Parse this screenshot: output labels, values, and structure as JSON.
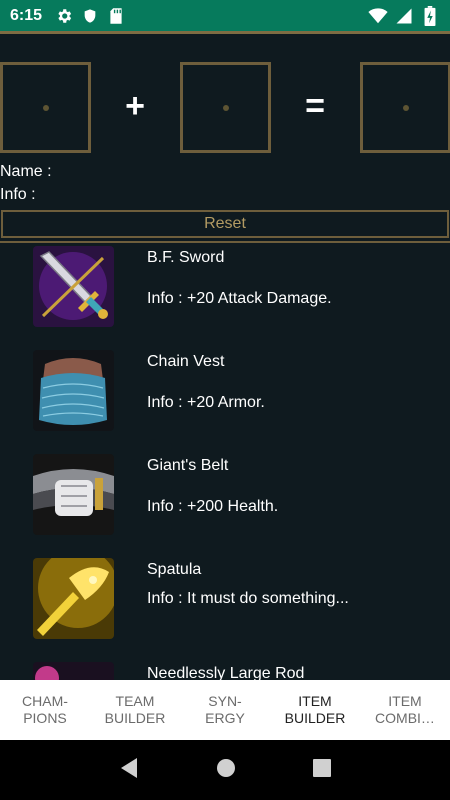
{
  "status_bar": {
    "time": "6:15",
    "icons_left": [
      "settings-icon",
      "shield-icon",
      "sd-card-icon"
    ],
    "icons_right": [
      "wifi-icon",
      "signal-icon",
      "battery-charging-icon"
    ],
    "background": "#067a5c"
  },
  "combiner": {
    "plus": "+",
    "equals": "=",
    "name_label": "Name :",
    "info_label": "Info :",
    "reset_label": "Reset"
  },
  "items": [
    {
      "name": "B.F. Sword",
      "info": "Info : +20 Attack Damage.",
      "icon": "bf-sword-icon"
    },
    {
      "name": "Chain Vest",
      "info": "Info : +20 Armor.",
      "icon": "chain-vest-icon"
    },
    {
      "name": "Giant's Belt",
      "info": "Info : +200 Health.",
      "icon": "giants-belt-icon"
    },
    {
      "name": "Spatula",
      "info": "Info : It must do something...",
      "icon": "spatula-icon"
    },
    {
      "name": "Needlessly Large Rod",
      "info": "",
      "icon": "needlessly-large-rod-icon"
    }
  ],
  "tabs": [
    {
      "label": "CHAM-\nPIONS",
      "active": false
    },
    {
      "label": "TEAM\nBUILDER",
      "active": false
    },
    {
      "label": "SYN-\nERGY",
      "active": false
    },
    {
      "label": "ITEM\nBUILDER",
      "active": true
    },
    {
      "label": "ITEM\nCOMBI…",
      "active": false
    }
  ],
  "nav_bar": [
    "back-icon",
    "home-icon",
    "recents-icon"
  ],
  "colors": {
    "background": "#0f1a1f",
    "gold_border": "#6e5e3c",
    "reset_text": "#b39b63"
  }
}
